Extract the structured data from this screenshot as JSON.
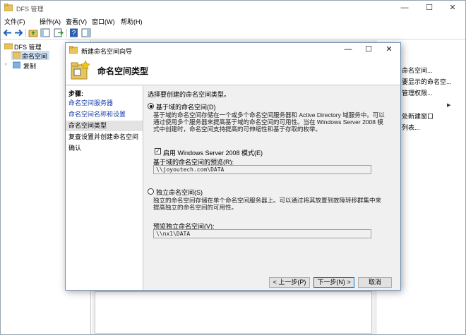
{
  "window": {
    "title": "DFS 管理",
    "min_glyph": "—",
    "max_glyph": "☐",
    "close_glyph": "✕"
  },
  "menu": [
    "文件(F)",
    "操作(A)",
    "查看(V)",
    "窗口(W)",
    "帮助(H)"
  ],
  "tree": {
    "root": "DFS 管理",
    "items": [
      "命名空间",
      "复制"
    ]
  },
  "actions": {
    "items": [
      {
        "label": "命名空间...",
        "arrow": false
      },
      {
        "label": "要显示的命名空...",
        "arrow": false
      },
      {
        "label": "管理权限...",
        "arrow": false
      },
      {
        "label": "",
        "arrow": true
      },
      {
        "label": "处新建窗口",
        "arrow": false
      },
      {
        "label": "",
        "arrow": false
      },
      {
        "label": "列表...",
        "arrow": false
      }
    ]
  },
  "wizard": {
    "title": "新建命名空间向导",
    "header_title": "命名空间类型",
    "steps_title": "步骤:",
    "steps": [
      {
        "label": "命名空间服务器",
        "state": "done"
      },
      {
        "label": "命名空间名称和设置",
        "state": "done"
      },
      {
        "label": "命名空间类型",
        "state": "current"
      },
      {
        "label": "复查设置并创建命名空间",
        "state": "todo"
      },
      {
        "label": "确认",
        "state": "todo"
      }
    ],
    "prompt": "选择要创建的命名空间类型。",
    "domain_option": {
      "label": "基于域的命名空间(D)",
      "selected": true,
      "desc": "基于域的命名空间存储在一个或多个命名空间服务器和 Active Directory 域服务中。可以通过使用多个服务器来提高基于域的命名空间的可用性。当在 Windows Server 2008 模式中创建时，命名空间支持提高的可伸缩性和基于存取的枚举。"
    },
    "ws2008_mode": {
      "label": "启用 Windows Server 2008 模式(E)",
      "checked": true
    },
    "domain_preview_label": "基于域的命名空间的预览(R):",
    "domain_preview_value": "\\\\joyoutech.com\\DATA",
    "standalone_option": {
      "label": "独立命名空间(S)",
      "selected": false,
      "desc": "独立的命名空间存储在单个命名空间服务器上。可以通过将其放置到故障转移群集中来提高独立的命名空间的可用性。"
    },
    "standalone_preview_label": "预览独立命名空间(V):",
    "standalone_preview_value": "\\\\nx1\\DATA",
    "buttons": {
      "back": "< 上一步(P)",
      "next": "下一步(N) >",
      "cancel": "取消"
    }
  },
  "colors": {
    "accent": "#0078d7",
    "link": "#1a3fa8",
    "selection": "#cce0f5"
  }
}
